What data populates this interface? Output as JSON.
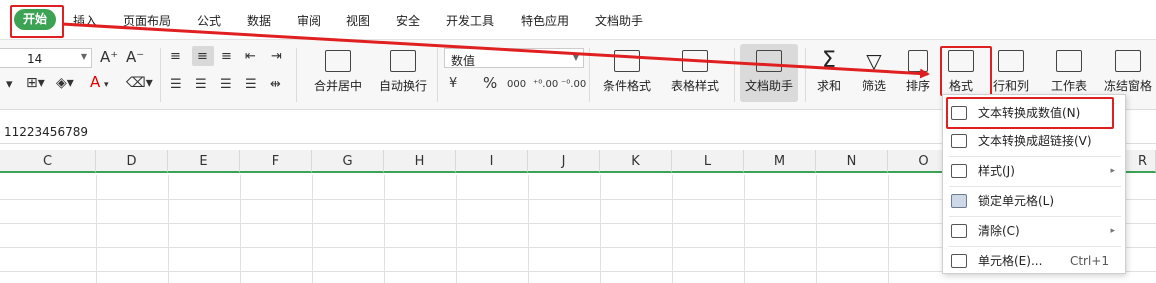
{
  "menubar": {
    "tabs": [
      {
        "label": "开始",
        "active": true
      },
      {
        "label": "插入"
      },
      {
        "label": "页面布局"
      },
      {
        "label": "公式"
      },
      {
        "label": "数据"
      },
      {
        "label": "审阅"
      },
      {
        "label": "视图"
      },
      {
        "label": "安全"
      },
      {
        "label": "开发工具"
      },
      {
        "label": "特色应用"
      },
      {
        "label": "文档助手"
      }
    ]
  },
  "ribbon": {
    "font_size": "14",
    "number_format": "数值",
    "merge_center": "合并居中",
    "auto_wrap": "自动换行",
    "percent_symbol": "%",
    "dec_increase": "⁺⁰.00",
    "dec_decrease": "⁻⁰.00",
    "currency_symbol": "¥",
    "thousands": "000",
    "conditional_format": "条件格式",
    "table_style": "表格样式",
    "doc_assistant": "文档助手",
    "sum": "求和",
    "filter": "筛选",
    "sort": "排序",
    "format": "格式",
    "rows_cols": "行和列",
    "worksheet": "工作表",
    "freeze": "冻结窗格"
  },
  "formula_bar": {
    "value": "11223456789"
  },
  "grid": {
    "columns": [
      "C",
      "D",
      "E",
      "F",
      "G",
      "H",
      "I",
      "J",
      "K",
      "L",
      "M",
      "N",
      "O",
      "R"
    ]
  },
  "context_menu": {
    "items": [
      {
        "label": "文本转换成数值(N)",
        "icon": "text-to-number-icon"
      },
      {
        "label": "文本转换成超链接(V)",
        "icon": "hyperlink-icon"
      },
      {
        "label": "样式(J)",
        "icon": "style-icon",
        "submenu": true
      },
      {
        "label": "锁定单元格(L)",
        "icon": "lock-cell-icon"
      },
      {
        "label": "清除(C)",
        "icon": "eraser-icon",
        "submenu": true
      },
      {
        "label": "单元格(E)...",
        "icon": "cell-format-icon",
        "shortcut": "Ctrl+1"
      }
    ]
  },
  "colors": {
    "active_tab": "#3ca354",
    "highlight": "#e02020",
    "accent_underline": "#3aa356"
  }
}
